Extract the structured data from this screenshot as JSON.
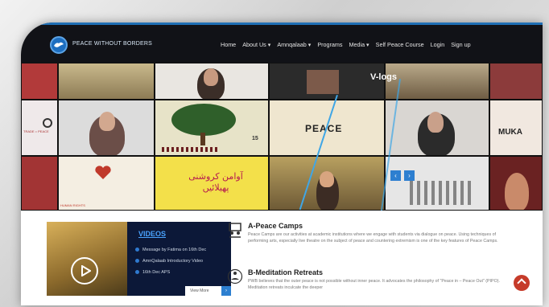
{
  "nav": {
    "brand": "PEACE WITHOUT BORDERS",
    "items": [
      {
        "label": "Home"
      },
      {
        "label": "About Us ▾"
      },
      {
        "label": "Amnqalaab ▾"
      },
      {
        "label": "Programs"
      },
      {
        "label": "Media ▾"
      },
      {
        "label": "Self Peace Course"
      },
      {
        "label": "Login"
      },
      {
        "label": "Sign up"
      }
    ]
  },
  "vlogs": {
    "title": "V-logs",
    "tile_texts": {
      "peace": "PEACE",
      "number": "15",
      "muka": "MUKA",
      "human_rights": "HUMAN RIGHTS",
      "urdu": "آوامن کروشنی پھیلائیں",
      "trade_peace": "TRADE = PEACE"
    },
    "prev": "‹",
    "next": "›"
  },
  "videos": {
    "heading": "VIDEOS",
    "items": [
      "Message by Fatima on 16th Dec",
      "AmnQalaab Introductory Video",
      "16th Dec APS"
    ],
    "view_more": "View More",
    "view_more_arrow": "›"
  },
  "sections": [
    {
      "title": "A-Peace Camps",
      "text": "Peace Camps are our activities at academic institutions where we engage with students via dialogue on peace. Using techniques of performing arts, especially live theatre on the subject of peace and countering extremism is one of the key features of Peace Camps."
    },
    {
      "title": "B-Meditation Retreats",
      "text": "PWB believes that the outer peace is not possible without inner peace. It advocates the philosophy of \"Peace in – Peace Out\" (PIPO). Meditation retreats inculcate the deeper"
    }
  ],
  "colors": {
    "accent": "#2d7fd0",
    "nav_bg": "#111217",
    "chat": "#c63b2a"
  }
}
